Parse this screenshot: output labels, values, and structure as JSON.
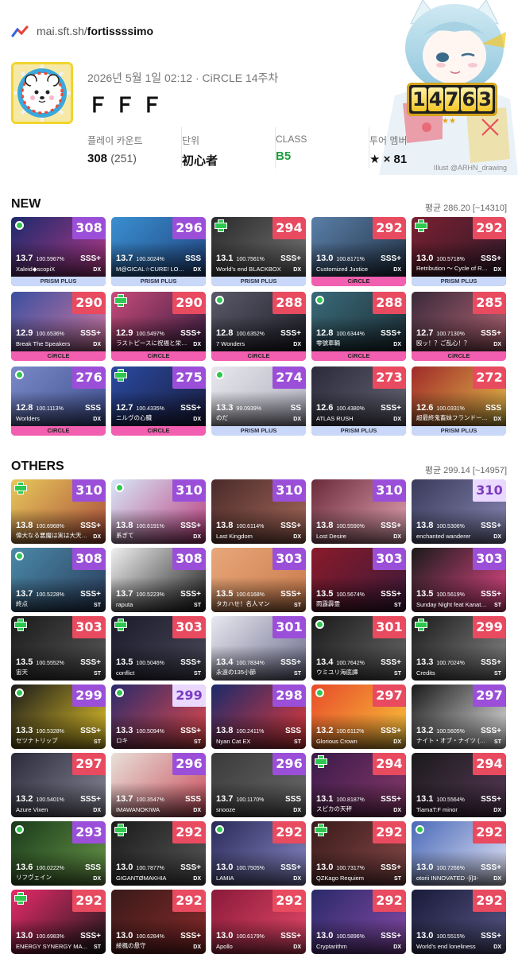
{
  "topbar": {
    "logo_icon": "site-logo-icon",
    "url_prefix": "mai.sft.sh/",
    "url_user": "fortissssimo"
  },
  "illustration": {
    "credit": "Illust @ARHN_drawing"
  },
  "profile": {
    "date_line": "2026년 5월 1일 02:12 · CiRCLE 14주차",
    "name": "ＦＦＦ",
    "rating_digits": [
      "1",
      "4",
      "7",
      "6",
      "3"
    ],
    "rating_stars": "★★",
    "stats": [
      {
        "label": "플레이 카운트",
        "value": "308",
        "sub": "(251)"
      },
      {
        "label": "단위",
        "value": "初心者",
        "sub": ""
      },
      {
        "label": "CLASS",
        "value": "B5",
        "sub": ""
      },
      {
        "label": "투어 멤버",
        "value": "★ × 81",
        "sub": ""
      }
    ]
  },
  "sections": {
    "new": {
      "title": "NEW",
      "average": "평균 286.20 [~14310]"
    },
    "others": {
      "title": "OTHERS",
      "average": "평균 299.14 [~14957]"
    }
  },
  "colors": {
    "master": "#9b4fd9",
    "remaster": "#ead8ff",
    "expert": "#e84a5f",
    "circle_badge": "#f35fb0",
    "prism_badge": "#c9d8f8"
  },
  "new_cards": [
    {
      "rating": "308",
      "level": "13.7",
      "accuracy": "100.5967%",
      "rank": "SSS+",
      "title": "Xaleid◆scopiX",
      "type": "DX",
      "diff": "mas",
      "mark": "dot",
      "badge": "PRISM PLUS",
      "art": [
        "#1b2a6b",
        "#c23a8a"
      ]
    },
    {
      "rating": "296",
      "level": "13.7",
      "accuracy": "100.3024%",
      "rank": "SSS",
      "title": "M@GICAL☆CURE! LOVE...",
      "type": "DX",
      "diff": "mas",
      "mark": "none",
      "badge": "PRISM PLUS",
      "art": [
        "#3a8fd0",
        "#1f3f7a"
      ]
    },
    {
      "rating": "294",
      "level": "13.1",
      "accuracy": "100.7561%",
      "rank": "SSS+",
      "title": "World's end BLACKBOX",
      "type": "DX",
      "diff": "exp",
      "mark": "plus",
      "badge": "PRISM PLUS",
      "art": [
        "#2a2a2a",
        "#7a7a7a"
      ]
    },
    {
      "rating": "292",
      "level": "13.0",
      "accuracy": "100.8171%",
      "rank": "SSS+",
      "title": "Customized Justice",
      "type": "DX",
      "diff": "exp",
      "mark": "none",
      "badge": "CiRCLE",
      "art": [
        "#5a7fa8",
        "#1f2d3f"
      ]
    },
    {
      "rating": "292",
      "level": "13.0",
      "accuracy": "100.5718%",
      "rank": "SSS+",
      "title": "Retribution 〜 Cycle of Re...",
      "type": "DX",
      "diff": "exp",
      "mark": "plus",
      "badge": "PRISM PLUS",
      "art": [
        "#7a2030",
        "#2a1a2a"
      ]
    },
    {
      "rating": "290",
      "level": "12.9",
      "accuracy": "100.6536%",
      "rank": "SSS+",
      "title": "Break The Speakers",
      "type": "DX",
      "diff": "exp",
      "mark": "none",
      "badge": "CiRCLE",
      "art": [
        "#3a4fa0",
        "#e07aa0"
      ]
    },
    {
      "rating": "290",
      "level": "12.9",
      "accuracy": "100.5497%",
      "rank": "SSS+",
      "title": "ラストピースに祝福と栄光...",
      "type": "DX",
      "diff": "exp",
      "mark": "plus",
      "badge": "CiRCLE",
      "art": [
        "#c84a7a",
        "#2a1a3a"
      ]
    },
    {
      "rating": "288",
      "level": "12.8",
      "accuracy": "100.6352%",
      "rank": "SSS+",
      "title": "7 Wonders",
      "type": "DX",
      "diff": "exp",
      "mark": "dot",
      "badge": "CiRCLE",
      "art": [
        "#5a5a6a",
        "#1a1a24"
      ]
    },
    {
      "rating": "288",
      "level": "12.8",
      "accuracy": "100.6344%",
      "rank": "SSS+",
      "title": "零號車輛",
      "type": "DX",
      "diff": "exp",
      "mark": "dot",
      "badge": "CiRCLE",
      "art": [
        "#3a6a7a",
        "#1a2a30"
      ]
    },
    {
      "rating": "285",
      "level": "12.7",
      "accuracy": "100.7130%",
      "rank": "SSS+",
      "title": "殴ッ！？ご乱心！？",
      "type": "DX",
      "diff": "exp",
      "mark": "none",
      "badge": "CiRCLE",
      "art": [
        "#3a2a3a",
        "#c06a7a"
      ]
    },
    {
      "rating": "276",
      "level": "12.8",
      "accuracy": "100.1113%",
      "rank": "SSS",
      "title": "Worlders",
      "type": "DX",
      "diff": "mas",
      "mark": "dot",
      "badge": "CiRCLE",
      "art": [
        "#7a8ac8",
        "#3a4a8a"
      ]
    },
    {
      "rating": "275",
      "level": "12.7",
      "accuracy": "100.4335%",
      "rank": "SSS+",
      "title": "ニルヴの心臓",
      "type": "DX",
      "diff": "mas",
      "mark": "plus",
      "badge": "CiRCLE",
      "art": [
        "#2a4aa0",
        "#1a1a3a"
      ]
    },
    {
      "rating": "274",
      "level": "13.3",
      "accuracy": "99.0939%",
      "rank": "SS",
      "title": "のだ",
      "type": "DX",
      "diff": "mas",
      "mark": "dot",
      "badge": "PRISM PLUS",
      "art": [
        "#e8e8ee",
        "#a8a8b8"
      ]
    },
    {
      "rating": "273",
      "level": "12.6",
      "accuracy": "100.4380%",
      "rank": "SSS+",
      "title": "ATLAS RUSH",
      "type": "DX",
      "diff": "exp",
      "mark": "none",
      "badge": "PRISM PLUS",
      "art": [
        "#2a2a3a",
        "#6a6a7a"
      ]
    },
    {
      "rating": "272",
      "level": "12.6",
      "accuracy": "100.0331%",
      "rank": "SSS",
      "title": "超最終鬼畜妹フランドール...",
      "type": "DX",
      "diff": "exp",
      "mark": "none",
      "badge": "PRISM PLUS",
      "art": [
        "#a02a2a",
        "#e8c84a"
      ]
    }
  ],
  "other_cards": [
    {
      "rating": "310",
      "level": "13.8",
      "accuracy": "100.6968%",
      "rank": "SSS+",
      "title": "偉大なる悪魔は実は大天使...",
      "type": "DX",
      "diff": "mas",
      "mark": "plus",
      "art": [
        "#e8c85a",
        "#a84a3a"
      ]
    },
    {
      "rating": "310",
      "level": "13.8",
      "accuracy": "100.6191%",
      "rank": "SSS+",
      "title": "系ぎて",
      "type": "DX",
      "diff": "mas",
      "mark": "dot",
      "art": [
        "#d8e8f8",
        "#b83a7a"
      ]
    },
    {
      "rating": "310",
      "level": "13.8",
      "accuracy": "100.6114%",
      "rank": "SSS+",
      "title": "Last Kingdom",
      "type": "DX",
      "diff": "mas",
      "mark": "none",
      "art": [
        "#4a2a2a",
        "#a86a5a"
      ]
    },
    {
      "rating": "310",
      "level": "13.8",
      "accuracy": "100.5590%",
      "rank": "SSS+",
      "title": "Lost Desire",
      "type": "DX",
      "diff": "mas",
      "mark": "none",
      "art": [
        "#6a2a3a",
        "#e8a8b8"
      ]
    },
    {
      "rating": "310",
      "level": "13.8",
      "accuracy": "100.5306%",
      "rank": "SSS+",
      "title": "enchanted wanderer",
      "type": "DX",
      "diff": "rem",
      "mark": "none",
      "art": [
        "#3a3a5a",
        "#8a8ab8"
      ]
    },
    {
      "rating": "308",
      "level": "13.7",
      "accuracy": "100.5228%",
      "rank": "SSS+",
      "title": "終点",
      "type": "ST",
      "diff": "mas",
      "mark": "dot",
      "art": [
        "#4a8aa8",
        "#2a3a5a"
      ]
    },
    {
      "rating": "308",
      "level": "13.7",
      "accuracy": "100.5223%",
      "rank": "SSS+",
      "title": "raputa",
      "type": "ST",
      "diff": "mas",
      "mark": "none",
      "art": [
        "#f0f0f0",
        "#1a1a1a"
      ]
    },
    {
      "rating": "303",
      "level": "13.5",
      "accuracy": "100.6168%",
      "rank": "SSS+",
      "title": "タカハせ！名人マン",
      "type": "ST",
      "diff": "mas",
      "mark": "none",
      "art": [
        "#e8a87a",
        "#c8784a"
      ]
    },
    {
      "rating": "303",
      "level": "13.5",
      "accuracy": "100.5674%",
      "rank": "SSS+",
      "title": "雨露霹霊",
      "type": "ST",
      "diff": "mas",
      "mark": "none",
      "art": [
        "#8a1a2a",
        "#3a1a3a"
      ]
    },
    {
      "rating": "303",
      "level": "13.5",
      "accuracy": "100.5619%",
      "rank": "SSS+",
      "title": "Sunday Night feat Kanata...",
      "type": "ST",
      "diff": "mas",
      "mark": "none",
      "art": [
        "#1a1a1a",
        "#e84a8a"
      ]
    },
    {
      "rating": "303",
      "level": "13.5",
      "accuracy": "100.5552%",
      "rank": "SSS+",
      "title": "宙天",
      "type": "ST",
      "diff": "exp",
      "mark": "plus",
      "art": [
        "#1a1a1a",
        "#5a5a5a"
      ]
    },
    {
      "rating": "303",
      "level": "13.5",
      "accuracy": "100.5046%",
      "rank": "SSS+",
      "title": "conflict",
      "type": "ST",
      "diff": "exp",
      "mark": "plus",
      "art": [
        "#1a1a2a",
        "#4a4a5a"
      ]
    },
    {
      "rating": "301",
      "level": "13.4",
      "accuracy": "100.7834%",
      "rank": "SSS+",
      "title": "永遠の135小節",
      "type": "ST",
      "diff": "mas",
      "mark": "none",
      "art": [
        "#e8e8f0",
        "#6a6a8a"
      ]
    },
    {
      "rating": "301",
      "level": "13.4",
      "accuracy": "100.7642%",
      "rank": "SSS+",
      "title": "ウミユリ海底譚",
      "type": "ST",
      "diff": "exp",
      "mark": "dot",
      "art": [
        "#1a1a1a",
        "#6a6a6a"
      ]
    },
    {
      "rating": "299",
      "level": "13.3",
      "accuracy": "100.7024%",
      "rank": "SSS+",
      "title": "Credits",
      "type": "ST",
      "diff": "exp",
      "mark": "plus",
      "art": [
        "#1a1a1a",
        "#8a8a8a"
      ]
    },
    {
      "rating": "299",
      "level": "13.3",
      "accuracy": "100.5328%",
      "rank": "SSS+",
      "title": "セツナトリップ",
      "type": "ST",
      "diff": "mas",
      "mark": "dot",
      "art": [
        "#1a1a1a",
        "#e8c82a"
      ]
    },
    {
      "rating": "299",
      "level": "13.3",
      "accuracy": "100.5094%",
      "rank": "SSS+",
      "title": "ロキ",
      "type": "ST",
      "diff": "rem",
      "mark": "dot",
      "art": [
        "#2a2a6a",
        "#e84a4a"
      ]
    },
    {
      "rating": "298",
      "level": "13.8",
      "accuracy": "100.2411%",
      "rank": "SSS",
      "title": "Nyan Cat EX",
      "type": "ST",
      "diff": "mas",
      "mark": "none",
      "art": [
        "#1a2a6a",
        "#e83a3a"
      ]
    },
    {
      "rating": "297",
      "level": "13.2",
      "accuracy": "100.6112%",
      "rank": "SSS+",
      "title": "Glorious Crown",
      "type": "DX",
      "diff": "exp",
      "mark": "dot",
      "art": [
        "#e84a2a",
        "#f8c83a"
      ]
    },
    {
      "rating": "297",
      "level": "13.2",
      "accuracy": "100.5605%",
      "rank": "SSS+",
      "title": "ナイト・オブ・ナイツ (Cr...",
      "type": "ST",
      "diff": "mas",
      "mark": "none",
      "art": [
        "#1a1a1a",
        "#e8e8e8"
      ]
    },
    {
      "rating": "297",
      "level": "13.2",
      "accuracy": "100.5401%",
      "rank": "SSS+",
      "title": "Azure Vixen",
      "type": "DX",
      "diff": "exp",
      "mark": "none",
      "art": [
        "#2a2a3a",
        "#8a8a9a"
      ]
    },
    {
      "rating": "296",
      "level": "13.7",
      "accuracy": "100.3547%",
      "rank": "SSS",
      "title": "IMAWANOKIWA",
      "type": "DX",
      "diff": "mas",
      "mark": "none",
      "art": [
        "#e8e0d8",
        "#c84a5a"
      ]
    },
    {
      "rating": "296",
      "level": "13.7",
      "accuracy": "100.1170%",
      "rank": "SSS",
      "title": "snooze",
      "type": "DX",
      "diff": "mas",
      "mark": "none",
      "art": [
        "#3a3a3a",
        "#6a6a6a"
      ]
    },
    {
      "rating": "294",
      "level": "13.1",
      "accuracy": "100.8187%",
      "rank": "SSS+",
      "title": "スピカの天秤",
      "type": "DX",
      "diff": "exp",
      "mark": "plus",
      "art": [
        "#3a1a4a",
        "#8a3a6a"
      ]
    },
    {
      "rating": "294",
      "level": "13.1",
      "accuracy": "100.5564%",
      "rank": "SSS+",
      "title": "TiamaT:F minor",
      "type": "DX",
      "diff": "exp",
      "mark": "none",
      "art": [
        "#1a1a1a",
        "#5a3a5a"
      ]
    },
    {
      "rating": "293",
      "level": "13.6",
      "accuracy": "100.0222%",
      "rank": "SSS",
      "title": "リフヴェイン",
      "type": "DX",
      "diff": "mas",
      "mark": "dot",
      "art": [
        "#1a3a1a",
        "#6a9a4a"
      ]
    },
    {
      "rating": "292",
      "level": "13.0",
      "accuracy": "100.7877%",
      "rank": "SSS+",
      "title": "GIGANTØMAKHIA",
      "type": "DX",
      "diff": "exp",
      "mark": "plus",
      "art": [
        "#1a1a1a",
        "#5a5a5a"
      ]
    },
    {
      "rating": "292",
      "level": "13.0",
      "accuracy": "100.7505%",
      "rank": "SSS+",
      "title": "LAMIA",
      "type": "DX",
      "diff": "exp",
      "mark": "dot",
      "art": [
        "#2a2a5a",
        "#8a8ac8"
      ]
    },
    {
      "rating": "292",
      "level": "13.0",
      "accuracy": "100.7317%",
      "rank": "SSS+",
      "title": "QZKago Requiem",
      "type": "ST",
      "diff": "exp",
      "mark": "plus",
      "art": [
        "#3a1a1a",
        "#8a4a4a"
      ]
    },
    {
      "rating": "292",
      "level": "13.0",
      "accuracy": "100.7266%",
      "rank": "SSS+",
      "title": "otorii INNOVATED -[i]3-",
      "type": "DX",
      "diff": "exp",
      "mark": "dot",
      "art": [
        "#4a6ab8",
        "#e8e8f8"
      ]
    },
    {
      "rating": "292",
      "level": "13.0",
      "accuracy": "100.6983%",
      "rank": "SSS+",
      "title": "ENERGY SYNERGY MATR...",
      "type": "ST",
      "diff": "exp",
      "mark": "plus",
      "art": [
        "#e82a6a",
        "#1a1a1a"
      ]
    },
    {
      "rating": "292",
      "level": "13.0",
      "accuracy": "100.6284%",
      "rank": "SSS+",
      "title": "綾楓の悬守",
      "type": "DX",
      "diff": "exp",
      "mark": "none",
      "art": [
        "#3a1a1a",
        "#8a2a2a"
      ]
    },
    {
      "rating": "292",
      "level": "13.0",
      "accuracy": "100.6179%",
      "rank": "SSS+",
      "title": "Apollo",
      "type": "DX",
      "diff": "exp",
      "mark": "none",
      "art": [
        "#8a1a3a",
        "#e84a6a"
      ]
    },
    {
      "rating": "292",
      "level": "13.0",
      "accuracy": "100.5896%",
      "rank": "SSS+",
      "title": "Cryptarithm",
      "type": "DX",
      "diff": "exp",
      "mark": "none",
      "art": [
        "#2a2a6a",
        "#8a4aa8"
      ]
    },
    {
      "rating": "292",
      "level": "13.0",
      "accuracy": "100.5515%",
      "rank": "SSS+",
      "title": "World's end loneliness",
      "type": "DX",
      "diff": "exp",
      "mark": "none",
      "art": [
        "#1a1a3a",
        "#5a5a8a"
      ]
    }
  ]
}
